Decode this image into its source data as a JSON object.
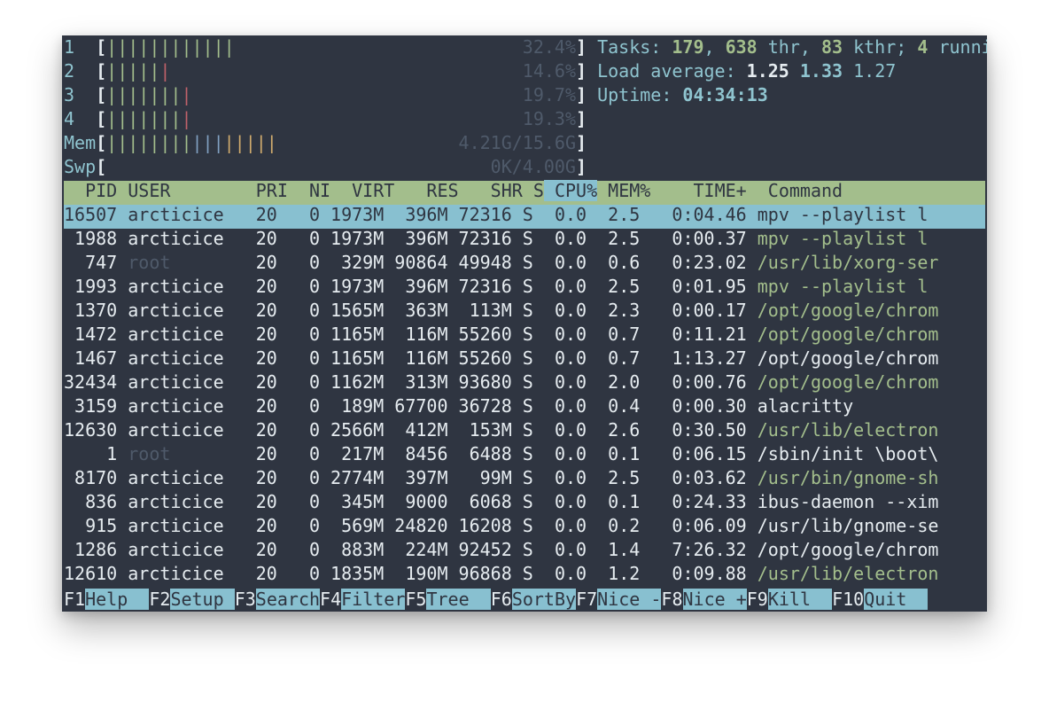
{
  "meters": {
    "cpu": [
      {
        "id": "1",
        "bar_green": "||||||||||||",
        "bar_red": "",
        "value": "32.4%"
      },
      {
        "id": "2",
        "bar_green": "|||||",
        "bar_red": "|",
        "value": "14.6%"
      },
      {
        "id": "3",
        "bar_green": "|||||||",
        "bar_red": "|",
        "value": "19.7%"
      },
      {
        "id": "4",
        "bar_green": "|||||||",
        "bar_red": "|",
        "value": "19.3%"
      }
    ],
    "mem": {
      "label": "Mem",
      "bar_green": "||||||||",
      "bar_blue": "|||",
      "bar_amber": "|||||",
      "value": "4.21G/15.6G"
    },
    "swp": {
      "label": "Swp",
      "value": "0K/4.00G"
    }
  },
  "summary": {
    "tasks_label": "Tasks:",
    "tasks": "179",
    "thr": "638",
    "thr_label": "thr,",
    "kthr": "83",
    "kthr_label": "kthr;",
    "running": "4",
    "running_label": "running",
    "load_label": "Load average:",
    "load1": "1.25",
    "load5": "1.33",
    "load15": "1.27",
    "uptime_label": "Uptime:",
    "uptime": "04:34:13"
  },
  "columns": [
    "  PID",
    " USER     ",
    "   PRI",
    "  NI",
    "  VIRT",
    "   RES",
    "   SHR",
    " S",
    " CPU%",
    " MEM%",
    "    TIME+ ",
    " Command"
  ],
  "processes": [
    {
      "pid": "16507",
      "user": "arcticice",
      "pri": "20",
      "ni": "0",
      "virt": "1973M",
      "res": "396M",
      "shr": "72316",
      "s": "S",
      "cpu": "0.0",
      "mem": "2.5",
      "time": "0:04.46",
      "cmd": "mpv --playlist l",
      "cmd_color": "selected"
    },
    {
      "pid": "1988",
      "user": "arcticice",
      "pri": "20",
      "ni": "0",
      "virt": "1973M",
      "res": "396M",
      "shr": "72316",
      "s": "S",
      "cpu": "0.0",
      "mem": "2.5",
      "time": "0:00.37",
      "cmd": "mpv --playlist l",
      "cmd_color": "green"
    },
    {
      "pid": "747",
      "user": "root",
      "pri": "20",
      "ni": "0",
      "virt": "329M",
      "res": "90864",
      "shr": "49948",
      "s": "S",
      "cpu": "0.0",
      "mem": "0.6",
      "time": "0:23.02",
      "cmd": "/usr/lib/xorg-ser",
      "cmd_color": "green"
    },
    {
      "pid": "1993",
      "user": "arcticice",
      "pri": "20",
      "ni": "0",
      "virt": "1973M",
      "res": "396M",
      "shr": "72316",
      "s": "S",
      "cpu": "0.0",
      "mem": "2.5",
      "time": "0:01.95",
      "cmd": "mpv --playlist l",
      "cmd_color": "green"
    },
    {
      "pid": "1370",
      "user": "arcticice",
      "pri": "20",
      "ni": "0",
      "virt": "1565M",
      "res": "363M",
      "shr": "113M",
      "s": "S",
      "cpu": "0.0",
      "mem": "2.3",
      "time": "0:00.17",
      "cmd": "/opt/google/chrom",
      "cmd_color": "green"
    },
    {
      "pid": "1472",
      "user": "arcticice",
      "pri": "20",
      "ni": "0",
      "virt": "1165M",
      "res": "116M",
      "shr": "55260",
      "s": "S",
      "cpu": "0.0",
      "mem": "0.7",
      "time": "0:11.21",
      "cmd": "/opt/google/chrom",
      "cmd_color": "green"
    },
    {
      "pid": "1467",
      "user": "arcticice",
      "pri": "20",
      "ni": "0",
      "virt": "1165M",
      "res": "116M",
      "shr": "55260",
      "s": "S",
      "cpu": "0.0",
      "mem": "0.7",
      "time": "1:13.27",
      "cmd": "/opt/google/chrom",
      "cmd_color": "white"
    },
    {
      "pid": "32434",
      "user": "arcticice",
      "pri": "20",
      "ni": "0",
      "virt": "1162M",
      "res": "313M",
      "shr": "93680",
      "s": "S",
      "cpu": "0.0",
      "mem": "2.0",
      "time": "0:00.76",
      "cmd": "/opt/google/chrom",
      "cmd_color": "green"
    },
    {
      "pid": "3159",
      "user": "arcticice",
      "pri": "20",
      "ni": "0",
      "virt": "189M",
      "res": "67700",
      "shr": "36728",
      "s": "S",
      "cpu": "0.0",
      "mem": "0.4",
      "time": "0:00.30",
      "cmd": "alacritty",
      "cmd_color": "white"
    },
    {
      "pid": "12630",
      "user": "arcticice",
      "pri": "20",
      "ni": "0",
      "virt": "2566M",
      "res": "412M",
      "shr": "153M",
      "s": "S",
      "cpu": "0.0",
      "mem": "2.6",
      "time": "0:30.50",
      "cmd": "/usr/lib/electron",
      "cmd_color": "green"
    },
    {
      "pid": "1",
      "user": "root",
      "pri": "20",
      "ni": "0",
      "virt": "217M",
      "res": "8456",
      "shr": "6488",
      "s": "S",
      "cpu": "0.0",
      "mem": "0.1",
      "time": "0:06.15",
      "cmd": "/sbin/init \\boot\\",
      "cmd_color": "white"
    },
    {
      "pid": "8170",
      "user": "arcticice",
      "pri": "20",
      "ni": "0",
      "virt": "2774M",
      "res": "397M",
      "shr": "99M",
      "s": "S",
      "cpu": "0.0",
      "mem": "2.5",
      "time": "0:03.62",
      "cmd": "/usr/bin/gnome-sh",
      "cmd_color": "green"
    },
    {
      "pid": "836",
      "user": "arcticice",
      "pri": "20",
      "ni": "0",
      "virt": "345M",
      "res": "9000",
      "shr": "6068",
      "s": "S",
      "cpu": "0.0",
      "mem": "0.1",
      "time": "0:24.33",
      "cmd": "ibus-daemon --xim",
      "cmd_color": "white"
    },
    {
      "pid": "915",
      "user": "arcticice",
      "pri": "20",
      "ni": "0",
      "virt": "569M",
      "res": "24820",
      "shr": "16208",
      "s": "S",
      "cpu": "0.0",
      "mem": "0.2",
      "time": "0:06.09",
      "cmd": "/usr/lib/gnome-se",
      "cmd_color": "white"
    },
    {
      "pid": "1286",
      "user": "arcticice",
      "pri": "20",
      "ni": "0",
      "virt": "883M",
      "res": "224M",
      "shr": "92452",
      "s": "S",
      "cpu": "0.0",
      "mem": "1.4",
      "time": "7:26.32",
      "cmd": "/opt/google/chrom",
      "cmd_color": "white"
    },
    {
      "pid": "12610",
      "user": "arcticice",
      "pri": "20",
      "ni": "0",
      "virt": "1835M",
      "res": "190M",
      "shr": "96868",
      "s": "S",
      "cpu": "0.0",
      "mem": "1.2",
      "time": "0:09.88",
      "cmd": "/usr/lib/electron",
      "cmd_color": "green"
    }
  ],
  "function_keys": [
    {
      "key": "F1",
      "label": "Help  "
    },
    {
      "key": "F2",
      "label": "Setup "
    },
    {
      "key": "F3",
      "label": "Search"
    },
    {
      "key": "F4",
      "label": "Filter"
    },
    {
      "key": "F5",
      "label": "Tree  "
    },
    {
      "key": "F6",
      "label": "SortBy"
    },
    {
      "key": "F7",
      "label": "Nice -"
    },
    {
      "key": "F8",
      "label": "Nice +"
    },
    {
      "key": "F9",
      "label": "Kill  "
    },
    {
      "key": "F10",
      "label": "Quit  "
    }
  ],
  "colors": {
    "background": "#2f3541",
    "header_bg": "#a3be8c",
    "highlight": "#88c0d0",
    "meter_green": "#a3be8c",
    "meter_red": "#bf616a",
    "meter_blue": "#81a1c1",
    "meter_amber": "#d1ac6e"
  }
}
